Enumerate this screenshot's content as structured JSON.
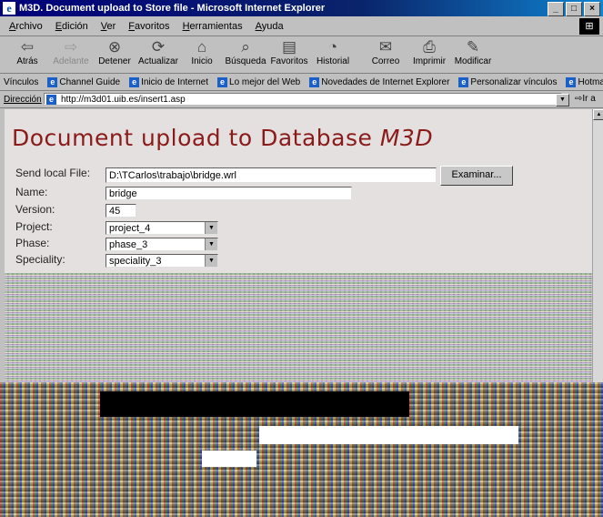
{
  "window": {
    "title": "M3D. Document upload to Store file - Microsoft Internet Explorer"
  },
  "menu": [
    "Archivo",
    "Edición",
    "Ver",
    "Favoritos",
    "Herramientas",
    "Ayuda"
  ],
  "toolbar": {
    "back": "Atrás",
    "forward": "Adelante",
    "stop": "Detener",
    "refresh": "Actualizar",
    "home": "Inicio",
    "search": "Búsqueda",
    "favorites": "Favoritos",
    "history": "Historial",
    "mail": "Correo",
    "print": "Imprimir",
    "edit": "Modificar"
  },
  "links": {
    "label": "Vínculos",
    "items": [
      "Channel Guide",
      "Inicio de Internet",
      "Lo mejor del Web",
      "Novedades de Internet Explorer",
      "Personalizar vínculos",
      "Hotmail gratuito"
    ]
  },
  "address": {
    "label": "Dirección",
    "url": "http://m3d01.uib.es/insert1.asp",
    "go": "Ir a"
  },
  "page": {
    "heading_main": "Document upload to Database",
    "heading_brand": "M3D",
    "send_label": "Send local File:",
    "send_value": "D:\\TCarlos\\trabajo\\bridge.wrl",
    "browse_label": "Examinar...",
    "name_label": "Name:",
    "name_value": "bridge",
    "version_label": "Version:",
    "version_value": "45",
    "project_label": "Project:",
    "project_value": "project_4",
    "phase_label": "Phase:",
    "phase_value": "phase_3",
    "speciality_label": "Speciality:",
    "speciality_value": "speciality_3"
  },
  "colors": {
    "heading": "#8b1a1a",
    "titlebar": "#0a246a"
  }
}
